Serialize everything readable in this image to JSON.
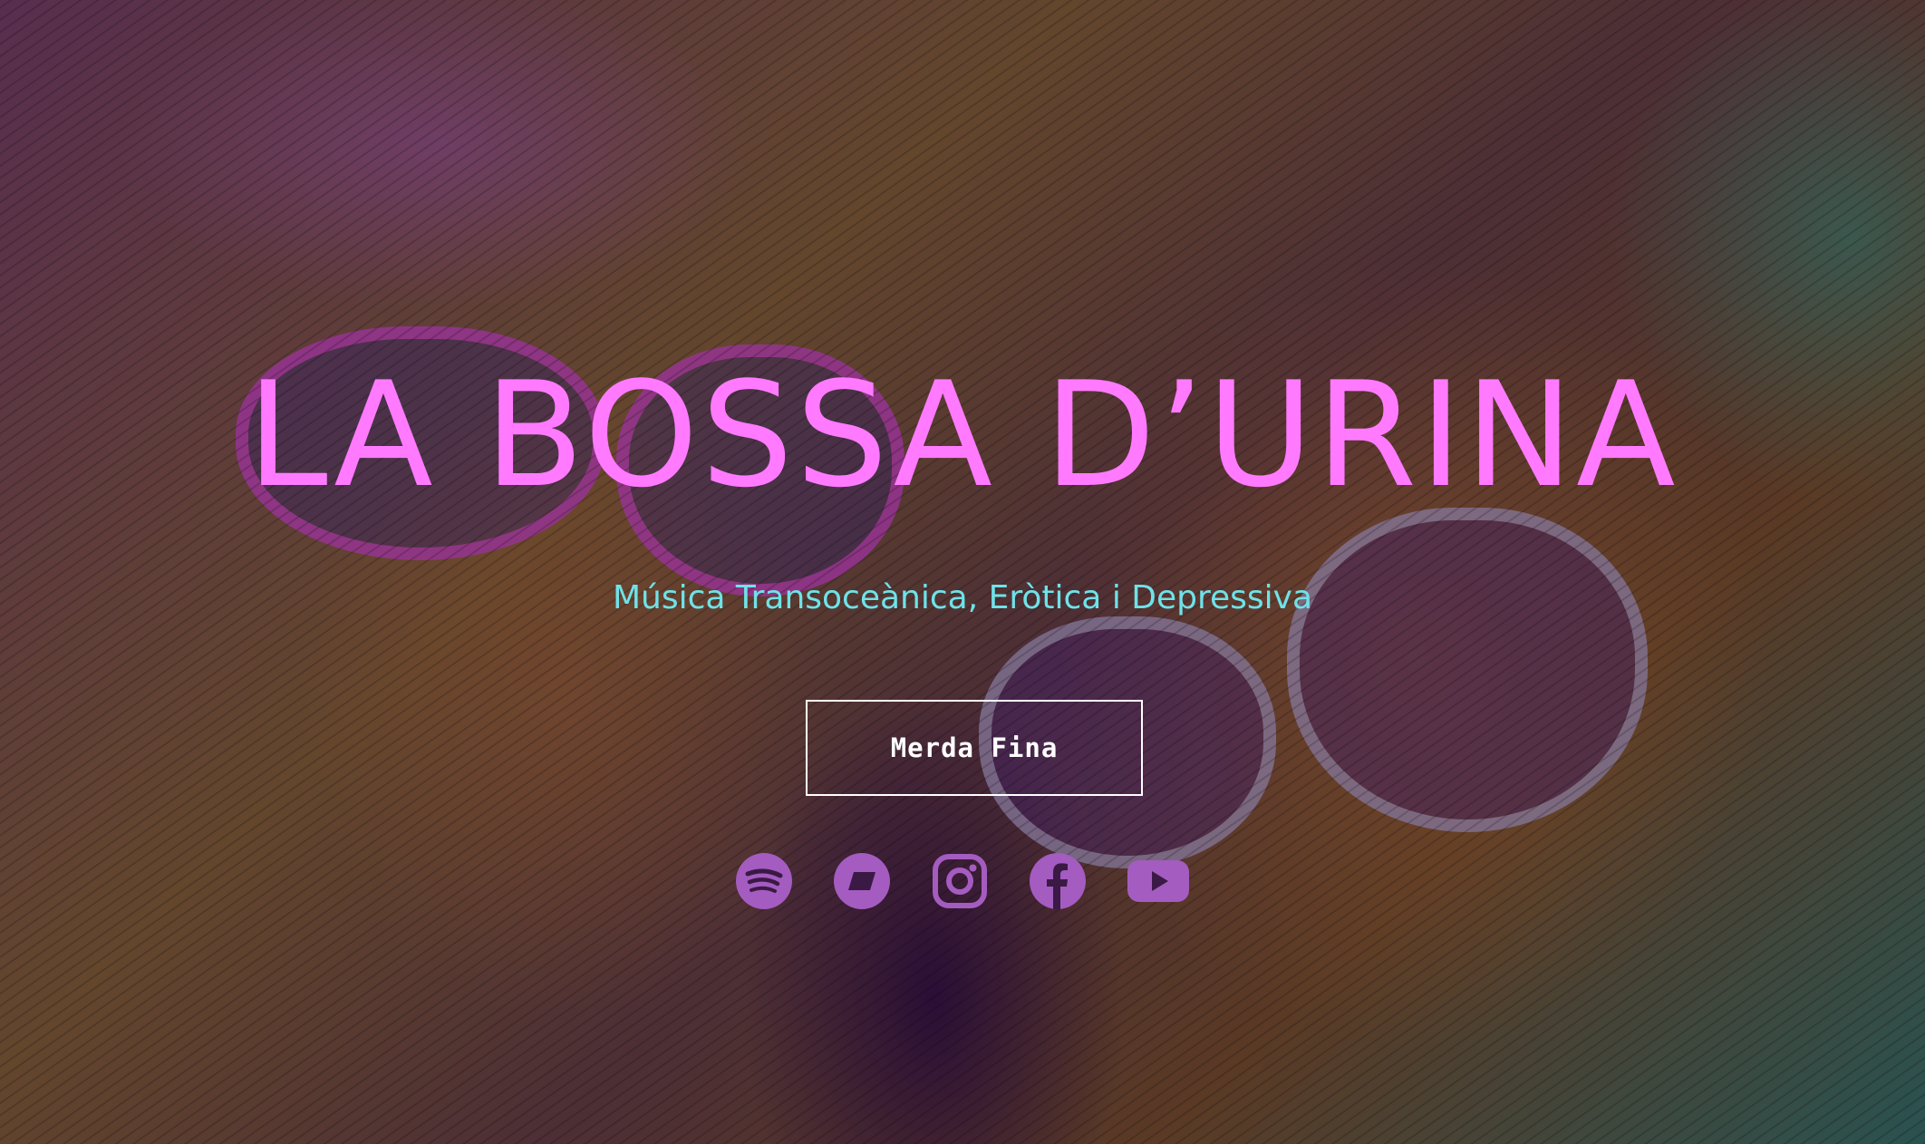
{
  "hero": {
    "title": "LA BOSSA D’URINA",
    "subtitle": "Música Transoceànica, Eròtica i Depressiva",
    "cta_label": "Merda Fina",
    "background": "band-photo-artwork"
  },
  "social": {
    "icons": [
      "spotify-icon",
      "bandcamp-icon",
      "instagram-icon",
      "facebook-icon",
      "youtube-icon"
    ],
    "icon_color": "#a45cc0"
  },
  "colors": {
    "title": "#ff7aff",
    "subtitle": "#6ee3e8",
    "button_border": "#ffffff"
  }
}
